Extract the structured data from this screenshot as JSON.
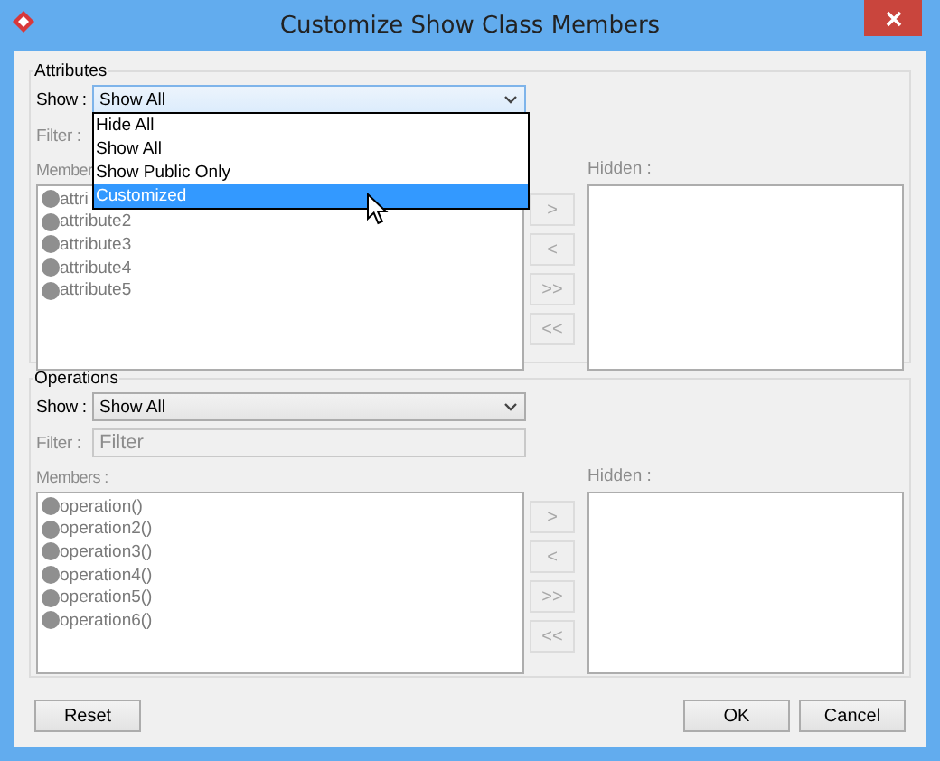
{
  "window": {
    "title": "Customize Show Class Members"
  },
  "attributes": {
    "title": "Attributes",
    "show_label": "Show :",
    "show_value": "Show All",
    "dropdown_open": true,
    "options": [
      {
        "label": "Hide All",
        "selected": false
      },
      {
        "label": "Show All",
        "selected": false
      },
      {
        "label": "Show Public Only",
        "selected": false
      },
      {
        "label": "Customized",
        "selected": true
      }
    ],
    "filter_label": "Filter :",
    "members_label": "Member",
    "members": [
      "attri",
      "attribute2",
      "attribute3",
      "attribute4",
      "attribute5"
    ],
    "buttons": [
      {
        "label": ">",
        "disabled": true
      },
      {
        "label": "<",
        "disabled": true
      },
      {
        "label": ">>",
        "disabled": true
      },
      {
        "label": "<<",
        "disabled": true
      }
    ],
    "hidden_label": "Hidden :"
  },
  "operations": {
    "title": "Operations",
    "show_label": "Show :",
    "show_value": "Show All",
    "dropdown_open": false,
    "filter_label": "Filter :",
    "filter_placeholder": "Filter",
    "members_label": "Members :",
    "members": [
      "operation()",
      "operation2()",
      "operation3()",
      "operation4()",
      "operation5()",
      "operation6()"
    ],
    "buttons": [
      {
        "label": ">",
        "disabled": true
      },
      {
        "label": "<",
        "disabled": true
      },
      {
        "label": ">>",
        "disabled": true
      },
      {
        "label": "<<",
        "disabled": true
      }
    ],
    "hidden_label": "Hidden :"
  },
  "footer": {
    "reset": "Reset",
    "ok": "OK",
    "cancel": "Cancel"
  }
}
